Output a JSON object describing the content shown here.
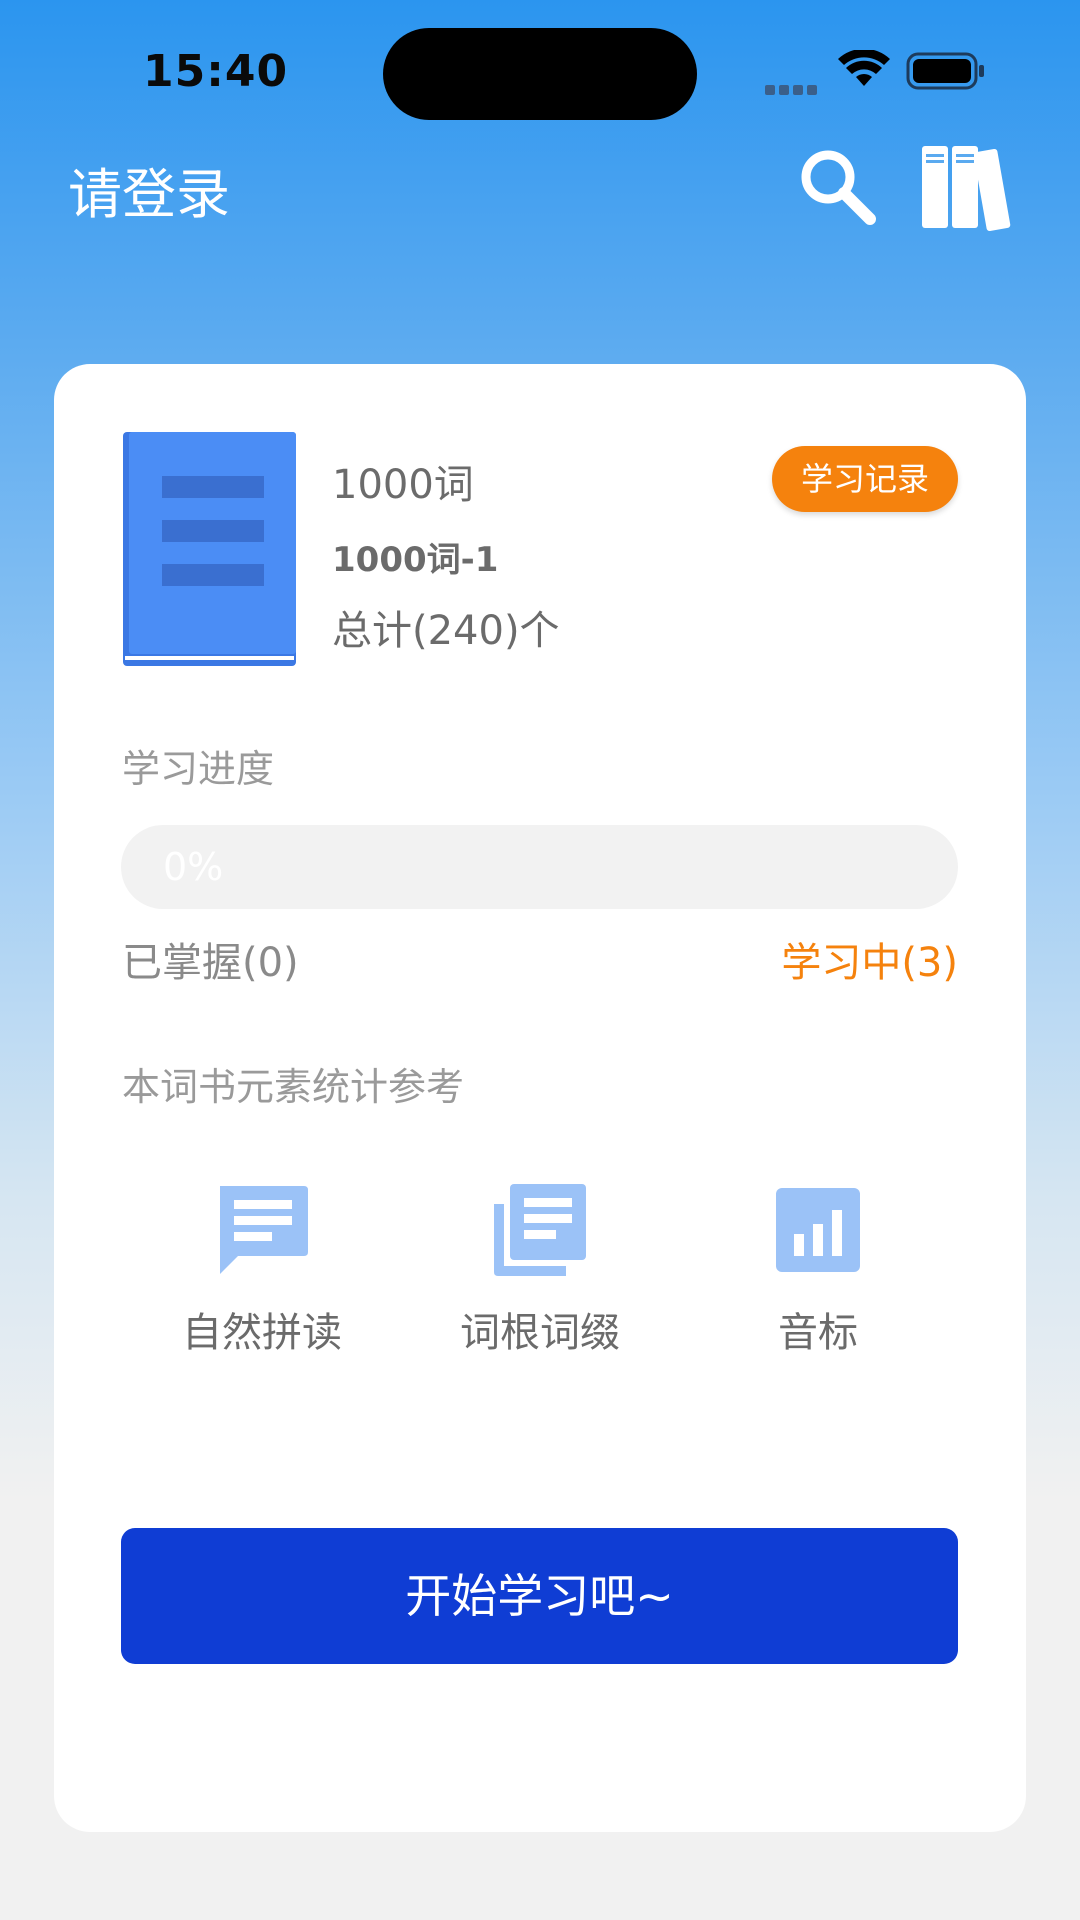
{
  "status_bar": {
    "time": "15:40"
  },
  "header": {
    "login_text": "请登录",
    "search_icon": "search-icon",
    "books_icon": "books-icon"
  },
  "book": {
    "name": "1000词",
    "unit": "1000词-1",
    "total": "总计(240)个",
    "record_button": "学习记录",
    "cover_icon": "book-cover-icon"
  },
  "progress": {
    "label": "学习进度",
    "percent_text": "0%",
    "fraction": 0,
    "mastered": "已掌握(0)",
    "learning": "学习中(3)"
  },
  "stats": {
    "label": "本词书元素统计参考",
    "items": [
      {
        "label": "自然拼读",
        "icon": "chat-icon"
      },
      {
        "label": "词根词缀",
        "icon": "library-icon"
      },
      {
        "label": "音标",
        "icon": "bar-chart-icon"
      }
    ]
  },
  "start_button": "开始学习吧~",
  "colors": {
    "accent_orange": "#f5820d",
    "primary_blue": "#0f3dd4",
    "icon_blue": "#9bc2f7"
  }
}
